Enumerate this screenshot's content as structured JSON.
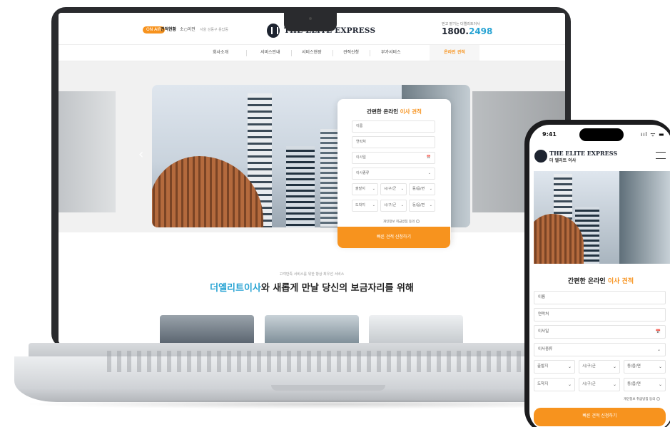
{
  "site": {
    "on_air": "ON AIR",
    "ticker_status": "견적현황",
    "ticker_name": "소○이전",
    "ticker_area": "서울 성동구 용답동",
    "brand": "THE ELITE EXPRESS",
    "phone_label": "믿고 맡기는 더엘리트이사",
    "phone_main": "1800.",
    "phone_accent": "2498",
    "nav": [
      "회사소개",
      "서비스안내",
      "서비스현장",
      "견적신청",
      "부가서비스"
    ],
    "nav_active": "온라인 견적",
    "slider_prev": "‹"
  },
  "form": {
    "title_pre": "간편한 온라인 ",
    "title_hl": "이사 견적",
    "name": "이름",
    "contact": "연락처",
    "date": "이사일",
    "date_icon": "📅",
    "type": "이사종류",
    "from": "출발지",
    "to": "도착지",
    "city": "시/구/군",
    "dong": "동/읍/면",
    "agree": "개인정보 취급방침 동의",
    "cta": "빠른 견적 신청하기",
    "chevron": "⌄"
  },
  "section": {
    "sub": "고객만족 서비스를 위한 항상 최우선 서비스",
    "head_acc": "더엘리트이사",
    "head_rest": "와 새롭게 만날 당신의 보금자리를 위해"
  },
  "mobile": {
    "time": "9:41",
    "status": "ııl ᯤ ▬",
    "brand": "THE ELITE EXPRESS",
    "brand_sub": "더 엘리트 이사"
  }
}
